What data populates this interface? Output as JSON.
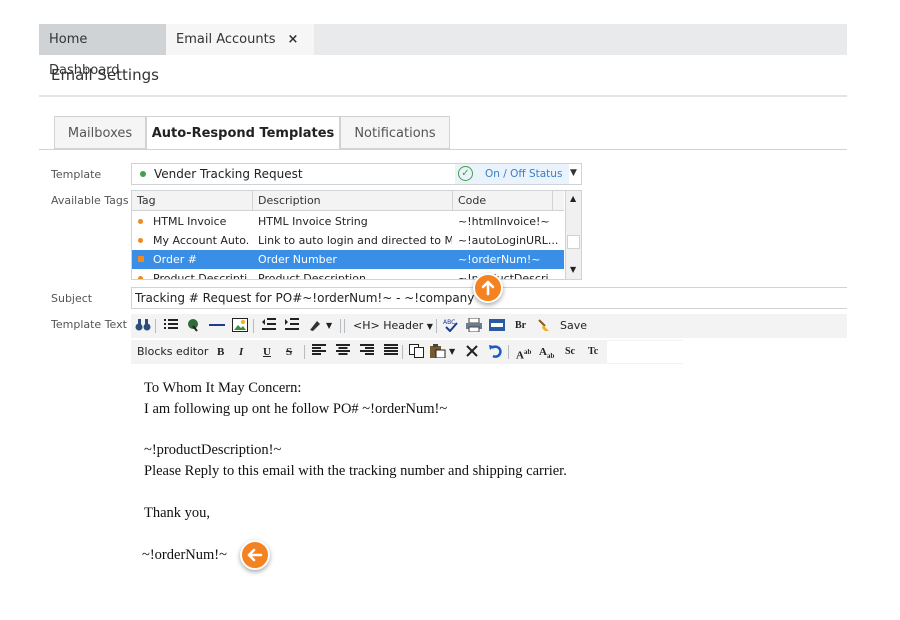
{
  "top_tabs": [
    {
      "label": "Home Dashboard"
    },
    {
      "label": "Email Accounts",
      "close": "×"
    }
  ],
  "page_title": "Email Settings",
  "sub_tabs": [
    {
      "label": "Mailboxes"
    },
    {
      "label": "Auto-Respond Templates"
    },
    {
      "label": "Notifications"
    }
  ],
  "form": {
    "template_label": "Template",
    "template_value": "Vender Tracking Request",
    "status_label": "On / Off Status",
    "available_tags_label": "Available Tags",
    "subject_label": "Subject",
    "subject_value": "Tracking # Request for PO#~!orderNum!~ - ~!companyName",
    "template_text_label": "Template Text"
  },
  "tags_grid": {
    "headers": [
      "Tag",
      "Description",
      "Code"
    ],
    "rows": [
      {
        "tag": "HTML Invoice",
        "description": "HTML Invoice String",
        "code": "~!htmlInvoice!~"
      },
      {
        "tag": "My Account Auto...",
        "description": "Link to auto login and directed to My...",
        "code": "~!autoLoginURL..."
      },
      {
        "tag": "Order #",
        "description": "Order Number",
        "code": "~!orderNum!~"
      },
      {
        "tag": "Product Descripti",
        "description": "Product Description",
        "code": "~!productDescri"
      }
    ],
    "selected_index": 2
  },
  "toolbar1": {
    "header_label": "<H> Header",
    "save_label": "Save",
    "br_label": "Br"
  },
  "toolbar2": {
    "blocks_label": "Blocks editor",
    "bold": "B",
    "italic": "I",
    "underline": "U",
    "strike": "S",
    "superscript": "A",
    "subscript": "A",
    "sc": "Sc",
    "tc": "Tc"
  },
  "editor_lines": [
    "To Whom It May Concern:",
    "I am following up ont he follow PO# ~!orderNum!~",
    "~!productDescription!~",
    "Please Reply to this email with the tracking number and shipping carrier.",
    "Thank you,",
    "~!orderNum!~"
  ],
  "colors": {
    "accent_orange": "#f58220",
    "selection_blue": "#3a8ee6",
    "status_green": "#43a047"
  }
}
